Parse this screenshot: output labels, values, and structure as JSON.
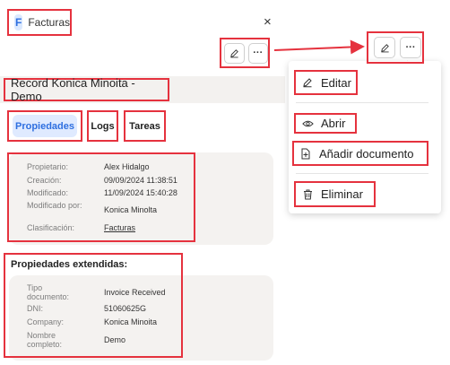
{
  "panel": {
    "badge": "F",
    "title": "Facturas",
    "close": "×",
    "record_title": "Record Konica Minoita - Demo",
    "tabs": [
      "Propiedades",
      "Logs",
      "Tareas"
    ],
    "properties": [
      {
        "label": "Propietario:",
        "value": "Alex Hidalgo"
      },
      {
        "label": "Creación:",
        "value": "09/09/2024 11:38:51"
      },
      {
        "label": "Modificado:",
        "value": "11/09/2024 15:40:28"
      },
      {
        "label": "Modificado por:",
        "value": "Konica Minolta"
      },
      {
        "label": "Clasificación:",
        "value": "Facturas"
      }
    ],
    "extended_title": "Propiedades extendidas:",
    "extended": [
      {
        "label": "Tipo documento:",
        "value": "Invoice Received"
      },
      {
        "label": "DNI:",
        "value": "51060625G"
      },
      {
        "label": "Company:",
        "value": "Konica Minoita"
      },
      {
        "label": "Nombre completo:",
        "value": "Demo"
      }
    ],
    "edit_icon": "pencil-icon",
    "more_icon": "ellipsis-icon",
    "more_glyph": "···"
  },
  "menu": {
    "items": [
      {
        "label": "Editar",
        "icon": "pencil-icon"
      },
      {
        "label": "Abrir",
        "icon": "eye-icon"
      },
      {
        "label": "Añadir documento",
        "icon": "add-file-icon"
      },
      {
        "label": "Eliminar",
        "icon": "trash-icon"
      }
    ]
  },
  "colors": {
    "highlight": "#e5323e",
    "accent": "#2e6fe0",
    "tab_active_bg": "#dfeaff"
  }
}
